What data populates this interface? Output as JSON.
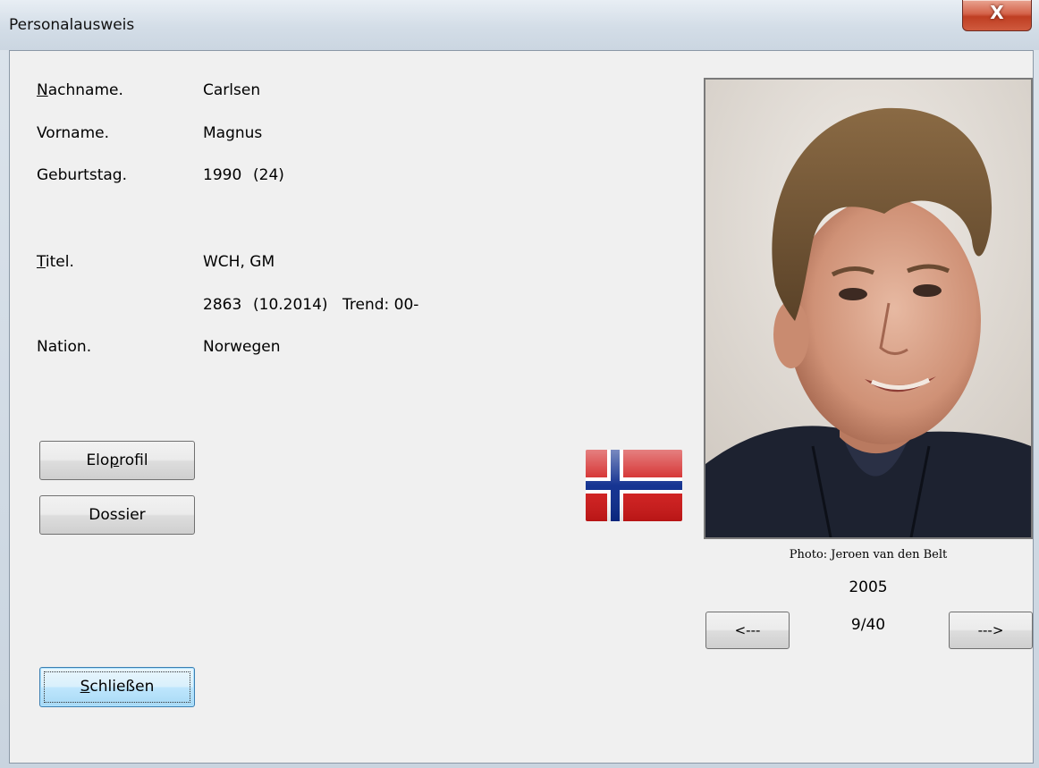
{
  "window": {
    "title": "Personalausweis",
    "close_label": "X"
  },
  "fields": {
    "nachname_label_mn": "N",
    "nachname_label_rest": "achname.",
    "nachname_value": "Carlsen",
    "vorname_label": "Vorname.",
    "vorname_value": "Magnus",
    "geburtstag_label": "Geburtstag.",
    "geburtstag_year": "1990",
    "geburtstag_age": "(24)",
    "titel_label_mn": "T",
    "titel_label_rest": "itel.",
    "titel_value": "WCH, GM",
    "elo_value": "2863",
    "elo_date": "(10.2014)",
    "elo_trend": "Trend: 00-",
    "nation_label": "Nation.",
    "nation_value": "Norwegen"
  },
  "buttons": {
    "eloprofil_pre": "Elo",
    "eloprofil_mn": "p",
    "eloprofil_post": "rofil",
    "dossier": "Dossier",
    "schliessen_mn": "S",
    "schliessen_rest": "chließen",
    "prev": "<---",
    "next": "--->"
  },
  "photo": {
    "caption": "Photo: Jeroen van den Belt",
    "year": "2005",
    "counter": "9/40"
  },
  "flag": {
    "country": "Norway",
    "red": "#d01818",
    "blue": "#0a2a8c",
    "white": "#ffffff"
  }
}
